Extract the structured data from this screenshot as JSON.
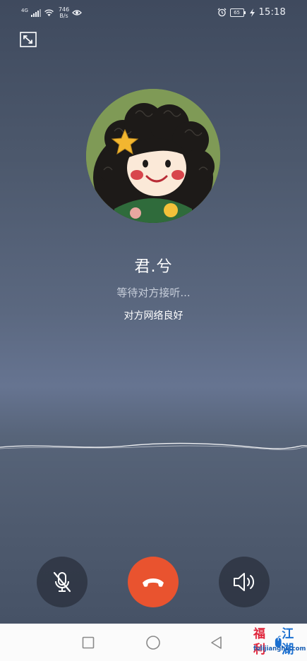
{
  "status_bar": {
    "network_type": "4G",
    "speed_value": "746",
    "speed_unit": "B/s",
    "battery_level": "65",
    "time": "15:18",
    "icons": [
      "signal-icon",
      "wifi-icon",
      "eye-icon",
      "alarm-icon",
      "battery-icon",
      "charging-icon"
    ]
  },
  "call": {
    "caller_name": "君.兮",
    "status": "等待对方接听...",
    "network_quality": "对方网络良好"
  },
  "controls": {
    "mute_icon": "mic-off-icon",
    "hangup_icon": "phone-hangup-icon",
    "speaker_icon": "speaker-icon"
  },
  "colors": {
    "hangup": "#e9532f",
    "background_top": "#3f4a5e",
    "background_mid": "#667491"
  },
  "nav_bar": {
    "icons": [
      "square-icon",
      "circle-icon",
      "back-triangle-icon"
    ]
  },
  "watermark": {
    "chinese_left": "福利",
    "chinese_right": "江湖",
    "url": "fulijianghu.com"
  }
}
